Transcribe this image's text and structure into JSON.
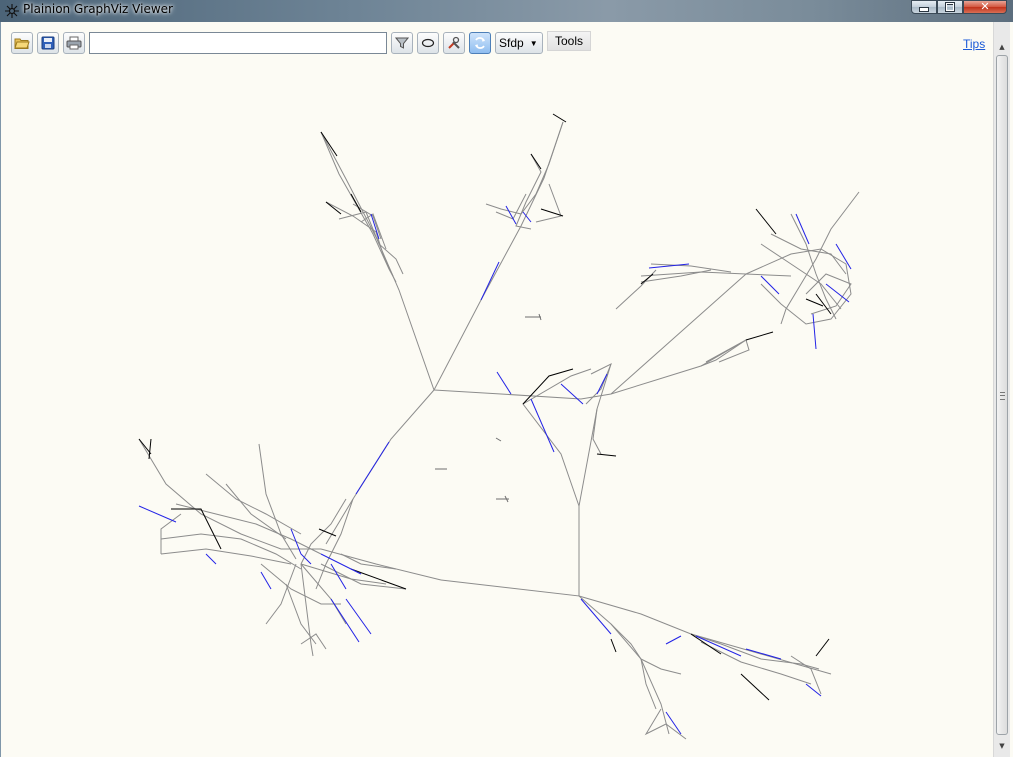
{
  "window": {
    "title": "Plainion GraphViz Viewer"
  },
  "toolbar": {
    "search_value": "",
    "layout_value": "Sfdp",
    "tools_label": "Tools",
    "tips_label": "Tips"
  },
  "colors": {
    "background": "#fcfbf4",
    "edge_gray": "#8c8c8c",
    "edge_blue": "#2323e6",
    "edge_black": "#000000",
    "link": "#1a5ad8"
  },
  "icons": [
    "app-icon",
    "open-folder-icon",
    "save-icon",
    "print-icon",
    "filter-icon",
    "ellipse-icon",
    "tools-icon",
    "refresh-icon",
    "chevron-down-icon"
  ]
}
